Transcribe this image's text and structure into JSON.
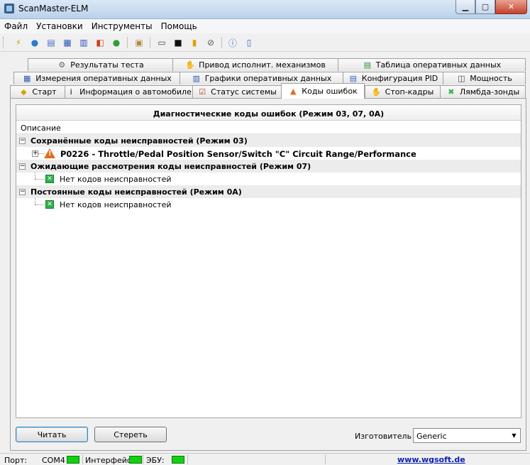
{
  "window": {
    "title": "ScanMaster-ELM"
  },
  "menu": [
    "Файл",
    "Установки",
    "Инструменты",
    "Помощь"
  ],
  "toolbar_icons": [
    "connect-icon",
    "globe-icon",
    "document-icon",
    "grid-icon",
    "chart-icon",
    "windows-flag-icon",
    "traffic-light-icon",
    "clipboard-icon",
    "chat-icon",
    "terminal-icon",
    "battery-icon",
    "stop-icon",
    "info-icon",
    "exit-icon"
  ],
  "tabs": {
    "row1": [
      "Результаты теста",
      "Привод исполнит. механизмов",
      "Таблица оперативных данных"
    ],
    "row2": [
      "Измерения оперативных данных",
      "Графики оперативных данных",
      "Конфигурация PID",
      "Мощность"
    ],
    "row3": [
      "Старт",
      "Информация о автомобиле",
      "Статус системы",
      "Коды ошибок",
      "Стоп-кадры",
      "Лямбда-зонды"
    ],
    "active": "Коды ошибок"
  },
  "tree": {
    "title": "Диагностические коды ошибок (Режим 03, 07, 0A)",
    "column": "Описание",
    "groups": [
      {
        "label": "Сохранённые коды неисправностей (Режим 03)",
        "item": "P0226 - Throttle/Pedal Position Sensor/Switch \"C\" Circuit Range/Performance"
      },
      {
        "label": "Ожидающие рассмотрения коды неисправностей (Режим 07)",
        "item": "Нет кодов неисправностей"
      },
      {
        "label": "Постоянные коды неисправностей  (Режим 0A)",
        "item": "Нет кодов неисправностей"
      }
    ]
  },
  "buttons": {
    "read": "Читать",
    "clear": "Стереть"
  },
  "manufacturer": {
    "label": "Изготовитель",
    "value": "Generic"
  },
  "status": {
    "port_label": "Порт:",
    "port_value": "COM4",
    "interface_label": "Интерфейс:",
    "ecu_label": "ЭБУ:",
    "website": "www.wgsoft.de",
    "led_color": "#11d111"
  }
}
